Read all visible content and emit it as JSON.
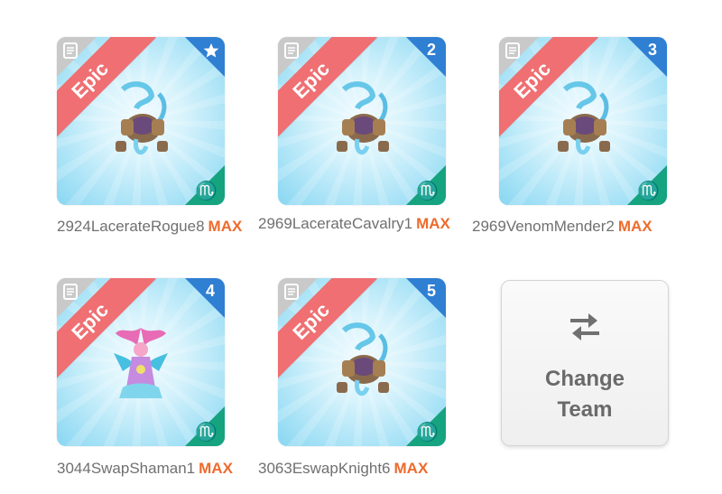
{
  "team": [
    {
      "rarity": "Epic",
      "slot": "",
      "slot_icon": "star-icon",
      "monster_icon": "golem-monster-icon",
      "name": "2924LacerateRogue8",
      "level": "MAX",
      "element_symbol": "♏"
    },
    {
      "rarity": "Epic",
      "slot": "2",
      "monster_icon": "golem-monster-icon",
      "name": "2969LacerateCavalry1",
      "level": "MAX",
      "element_symbol": "♏"
    },
    {
      "rarity": "Epic",
      "slot": "3",
      "monster_icon": "golem-monster-icon",
      "name": "2969VenomMender2",
      "level": "MAX",
      "element_symbol": "♏"
    },
    {
      "rarity": "Epic",
      "slot": "4",
      "monster_icon": "shaman-monster-icon",
      "name": "3044SwapShaman1",
      "level": "MAX",
      "element_symbol": "♏"
    },
    {
      "rarity": "Epic",
      "slot": "5",
      "monster_icon": "golem-monster-icon",
      "name": "3063EswapKnight6",
      "level": "MAX",
      "element_symbol": "♏"
    }
  ],
  "change_team": {
    "line1": "Change",
    "line2": "Team",
    "icon": "swap-arrows-icon"
  },
  "colors": {
    "epic_ribbon": "#ef6f72",
    "slot_badge": "#2f7fd3",
    "element_badge": "#16a37f",
    "max_label": "#ee6b2d"
  }
}
